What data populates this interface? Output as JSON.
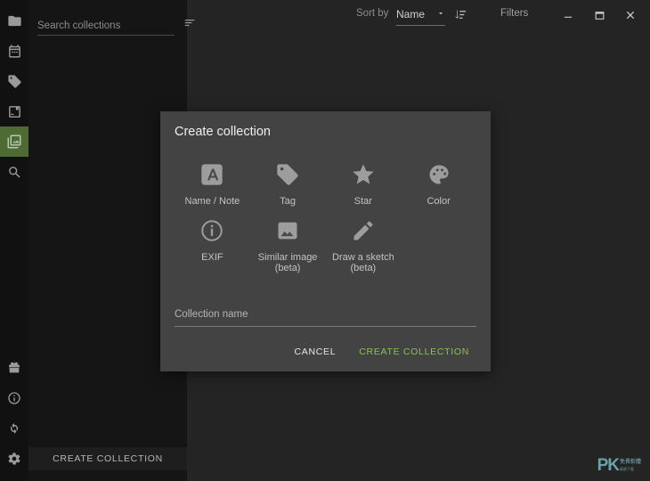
{
  "window": {
    "minimize_label": "Minimize",
    "maximize_label": "Maximize",
    "close_label": "Close"
  },
  "topbar": {
    "sort_by_label": "Sort by",
    "sort_value": "Name",
    "filters_label": "Filters"
  },
  "sidebar": {
    "items": [
      {
        "name": "folder",
        "label": "Folders",
        "active": false
      },
      {
        "name": "calendar",
        "label": "Calendar",
        "active": false
      },
      {
        "name": "tag",
        "label": "Tags",
        "active": false
      },
      {
        "name": "bookmark-image",
        "label": "Saved",
        "active": false
      },
      {
        "name": "collections",
        "label": "Collections",
        "active": true
      },
      {
        "name": "search",
        "label": "Search",
        "active": false
      }
    ],
    "bottom_items": [
      {
        "name": "gift",
        "label": "What's new"
      },
      {
        "name": "info",
        "label": "About"
      },
      {
        "name": "sync",
        "label": "Sync"
      },
      {
        "name": "settings",
        "label": "Settings"
      }
    ]
  },
  "panel": {
    "search_placeholder": "Search collections",
    "sort_icon": "sort-lines-icon",
    "create_collection_label": "CREATE COLLECTION"
  },
  "dialog": {
    "title": "Create collection",
    "options": [
      {
        "icon": "letter-a-icon",
        "label": "Name / Note",
        "sub": ""
      },
      {
        "icon": "tag-icon",
        "label": "Tag",
        "sub": ""
      },
      {
        "icon": "star-icon",
        "label": "Star",
        "sub": ""
      },
      {
        "icon": "palette-icon",
        "label": "Color",
        "sub": ""
      },
      {
        "icon": "info-circle-icon",
        "label": "EXIF",
        "sub": ""
      },
      {
        "icon": "image-icon",
        "label": "Similar image",
        "sub": "(beta)"
      },
      {
        "icon": "pencil-icon",
        "label": "Draw a sketch",
        "sub": "(beta)"
      }
    ],
    "name_placeholder": "Collection name",
    "name_value": "",
    "cancel_label": "CANCEL",
    "create_label": "CREATE COLLECTION"
  },
  "watermark": {
    "text": "PK",
    "subtext": "免費軟體",
    "subtext2": "資源下載"
  },
  "colors": {
    "accent_green": "#8bc34a",
    "sidebar_active": "#4e6b36",
    "dialog_bg": "#434343",
    "app_bg": "#242424",
    "panel_bg": "#151515",
    "rail_bg": "#111111"
  }
}
